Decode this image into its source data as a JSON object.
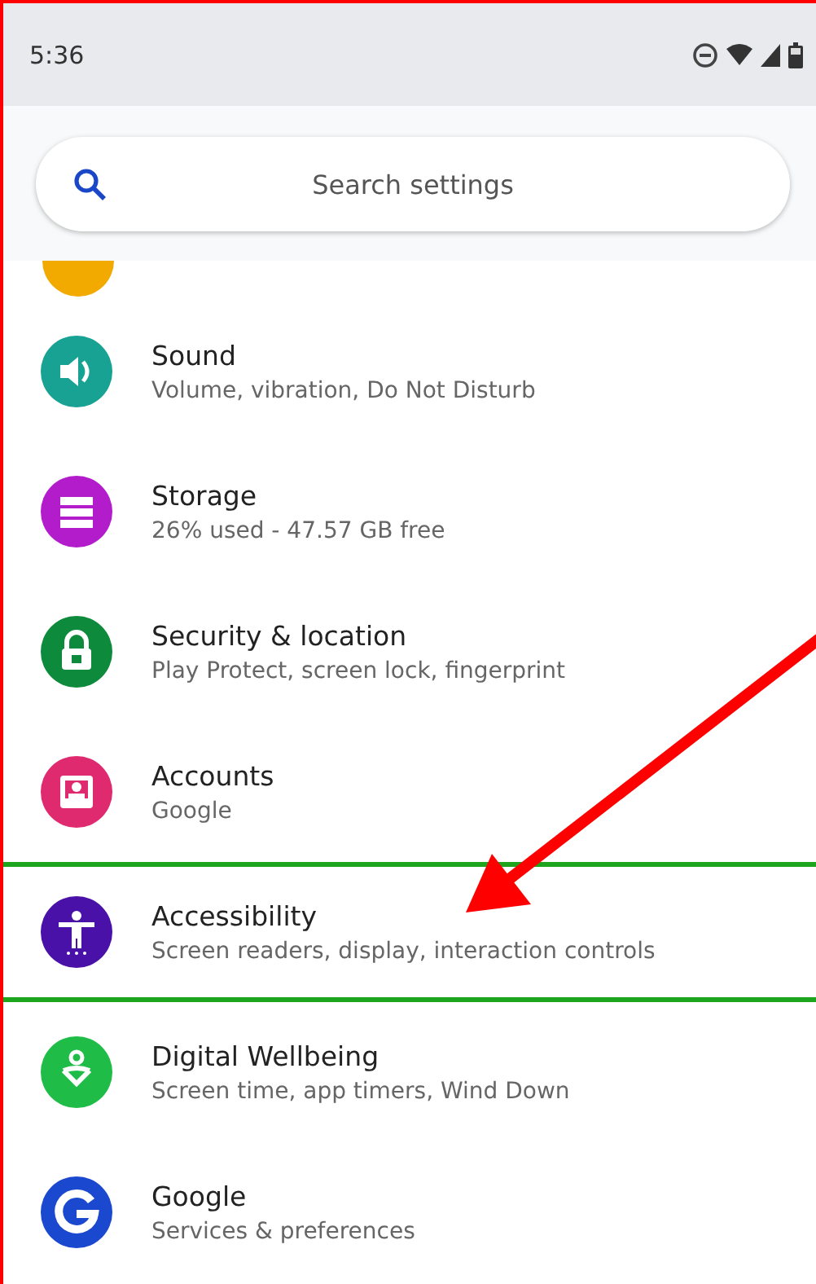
{
  "status_bar": {
    "time": "5:36"
  },
  "search": {
    "placeholder": "Search settings"
  },
  "items": [
    {
      "title": "Sound",
      "subtitle": "Volume, vibration, Do Not Disturb",
      "color": "#17a294",
      "highlighted": false
    },
    {
      "title": "Storage",
      "subtitle": "26% used - 47.57 GB free",
      "color": "#b21ccb",
      "highlighted": false
    },
    {
      "title": "Security & location",
      "subtitle": "Play Protect, screen lock, fingerprint",
      "color": "#0e8a3c",
      "highlighted": false
    },
    {
      "title": "Accounts",
      "subtitle": "Google",
      "color": "#e02a70",
      "highlighted": false
    },
    {
      "title": "Accessibility",
      "subtitle": "Screen readers, display, interaction controls",
      "color": "#4a11a8",
      "highlighted": true
    },
    {
      "title": "Digital Wellbeing",
      "subtitle": "Screen time, app timers, Wind Down",
      "color": "#1fbd47",
      "highlighted": false
    },
    {
      "title": "Google",
      "subtitle": "Services & preferences",
      "color": "#1a48cf",
      "highlighted": false
    }
  ]
}
